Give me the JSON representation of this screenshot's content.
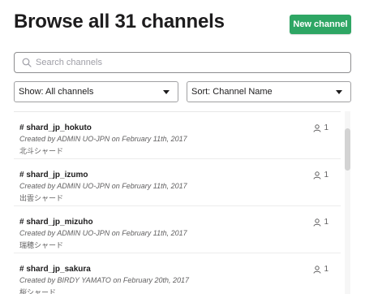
{
  "header": {
    "title": "Browse all 31 channels",
    "new_channel_label": "New channel"
  },
  "search": {
    "placeholder": "Search channels",
    "value": ""
  },
  "filters": {
    "show_label": "Show: All channels",
    "sort_label": "Sort: Channel Name"
  },
  "colors": {
    "accent": "#2ea664",
    "text": "#1d1c1d",
    "muted": "#616061"
  },
  "channels": [
    {
      "name": "# shard_jp_hokuto",
      "created_prefix": "Created by",
      "creator": "ADMIN UO-JPN",
      "created_on": "on February 11th, 2017",
      "purpose": "北斗シャード",
      "members": "1",
      "icon": "user-icon"
    },
    {
      "name": "# shard_jp_izumo",
      "created_prefix": "Created by",
      "creator": "ADMIN UO-JPN",
      "created_on": "on February 11th, 2017",
      "purpose": "出雲シャード",
      "members": "1",
      "icon": "user-icon"
    },
    {
      "name": "# shard_jp_mizuho",
      "created_prefix": "Created by",
      "creator": "ADMIN UO-JPN",
      "created_on": "on February 11th, 2017",
      "purpose": "瑞穂シャード",
      "members": "1",
      "icon": "user-icon"
    },
    {
      "name": "# shard_jp_sakura",
      "created_prefix": "Created by",
      "creator": "BIRDY YAMATO",
      "created_on": "on February 20th, 2017",
      "purpose": "桜シャード",
      "members": "1",
      "icon": "user-icon"
    }
  ]
}
